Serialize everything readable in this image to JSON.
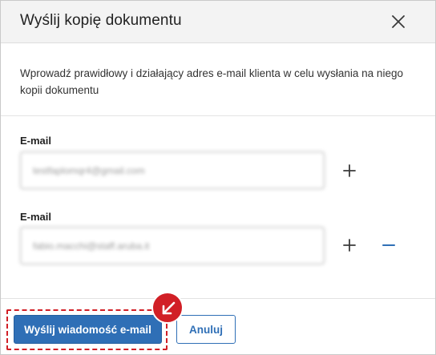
{
  "dialog": {
    "title": "Wyślij kopię dokumentu",
    "intro": "Wprowadź prawidłowy i działający adres e-mail klienta w celu wysłania na niego kopii dokumentu"
  },
  "emails": [
    {
      "label": "E-mail",
      "value": "testfaplomqr4@gmail.com"
    },
    {
      "label": "E-mail",
      "value": "fabio.macchi@staff.aruba.it"
    }
  ],
  "icons": {
    "close": "close-icon",
    "add": "plus-icon",
    "remove": "minus-icon",
    "callout": "arrow-down-left-icon"
  },
  "footer": {
    "send_label": "Wyślij wiadomość e-mail",
    "cancel_label": "Anuluj"
  },
  "colors": {
    "primary": "#2f6fb6",
    "highlight": "#d11f26",
    "header_bg": "#f3f3f3"
  }
}
